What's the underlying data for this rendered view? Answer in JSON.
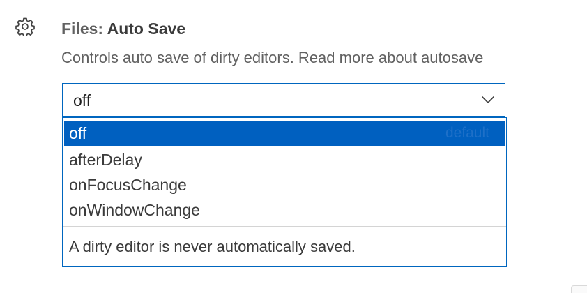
{
  "setting": {
    "gear_icon": "gear-icon",
    "category": "Files: ",
    "name": "Auto Save",
    "description": "Controls auto save of dirty editors. Read more about ",
    "description_link": "autosave",
    "select": {
      "value": "off",
      "chevron_icon": "chevron-down-icon"
    },
    "dropdown": {
      "options": [
        {
          "label": "off",
          "badge": "default",
          "selected": true
        },
        {
          "label": "afterDelay"
        },
        {
          "label": "onFocusChange"
        },
        {
          "label": "onWindowChange"
        }
      ],
      "option_description": "A dirty editor is never automatically saved."
    },
    "colors": {
      "focus_border": "#0066bf",
      "selected_background": "#0060c0",
      "text": "#3b3b3b",
      "muted_text": "#616161"
    }
  }
}
